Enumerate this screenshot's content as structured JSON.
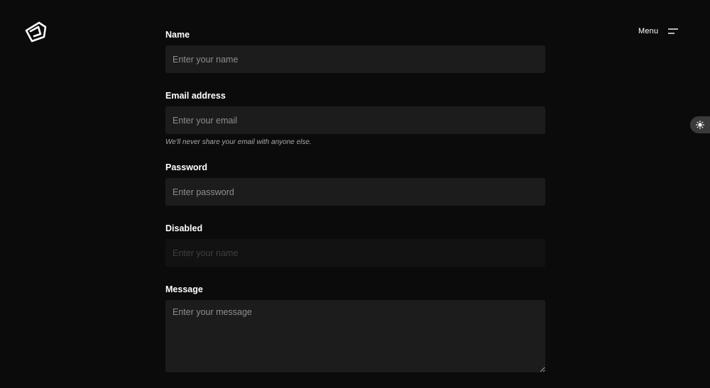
{
  "header": {
    "menu_label": "Menu",
    "logo_icon": "logo-icon",
    "menu_icon": "hamburger-icon",
    "theme_icon": "sun-icon"
  },
  "form": {
    "name": {
      "label": "Name",
      "placeholder": "Enter your name"
    },
    "email": {
      "label": "Email address",
      "placeholder": "Enter your email",
      "help": "We'll never share your email with anyone else."
    },
    "password": {
      "label": "Password",
      "placeholder": "Enter password"
    },
    "disabled": {
      "label": "Disabled",
      "placeholder": "Enter your name"
    },
    "message": {
      "label": "Message",
      "placeholder": "Enter your message"
    }
  },
  "colors": {
    "background": "#0b0b0b",
    "input_background": "#1c1c1c",
    "text": "#ffffff",
    "placeholder": "#8e8e8e"
  }
}
